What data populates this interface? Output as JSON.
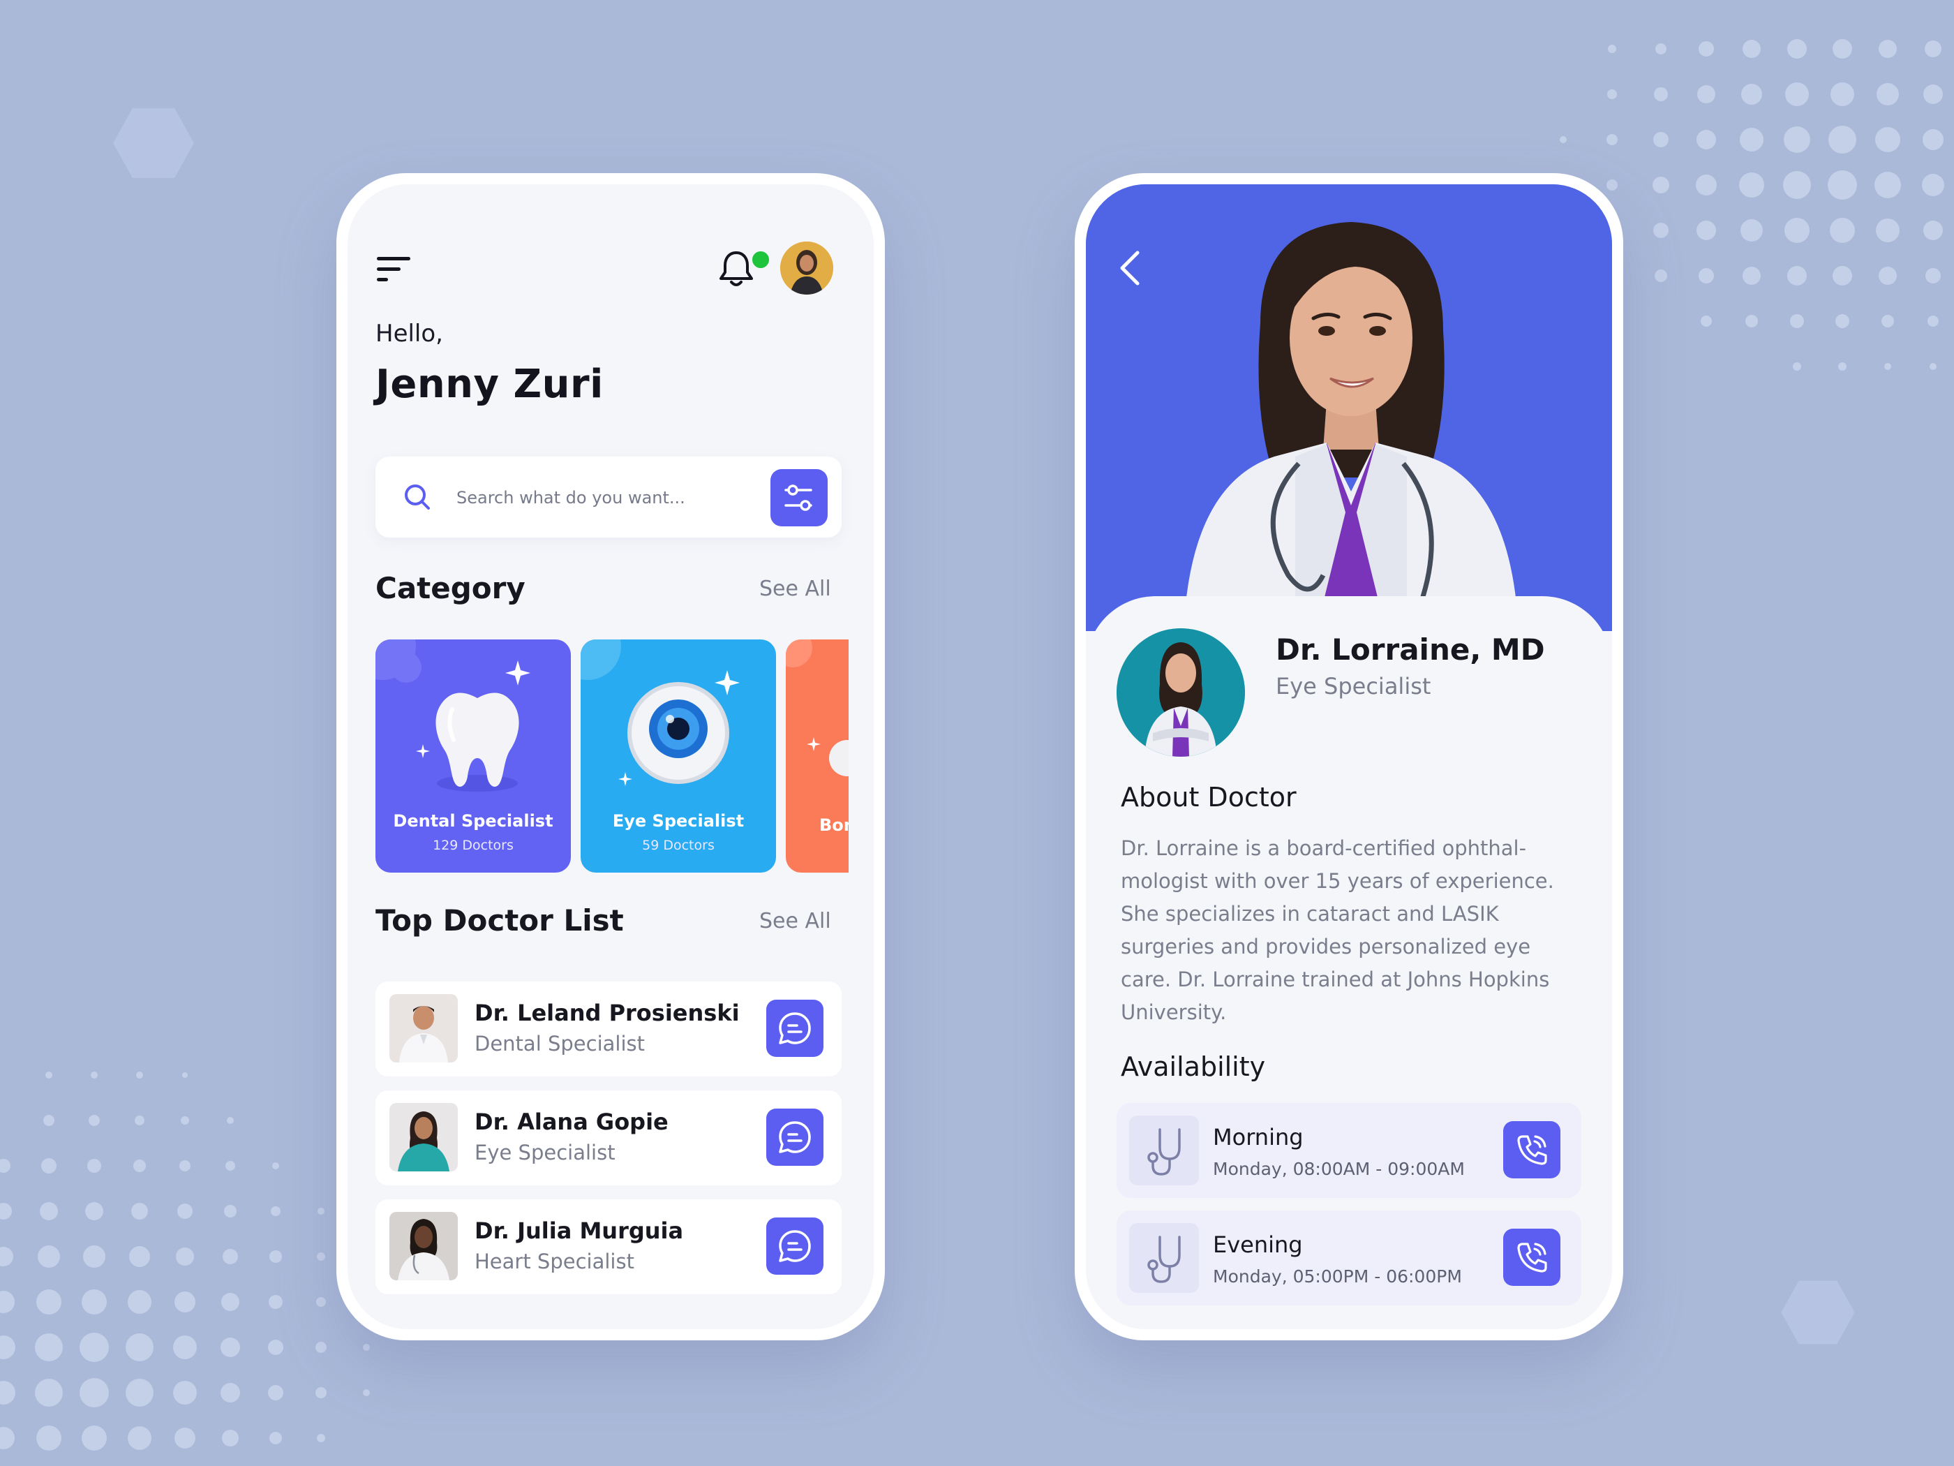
{
  "home": {
    "greeting": "Hello,",
    "user_name": "Jenny Zuri",
    "search": {
      "placeholder": "Search what do you want..."
    },
    "category_section": {
      "title": "Category",
      "see_all": "See All"
    },
    "categories": [
      {
        "title": "Dental Specialist",
        "count": "129 Doctors",
        "color": "#6262f3"
      },
      {
        "title": "Eye Specialist",
        "count": "59 Doctors",
        "color": "#28abf1"
      },
      {
        "title": "Bon",
        "color": "#fb7a58"
      }
    ],
    "doctor_section": {
      "title": "Top Doctor List",
      "see_all": "See All"
    },
    "doctors": [
      {
        "name": "Dr. Leland Prosienski",
        "specialty": "Dental Specialist"
      },
      {
        "name": "Dr. Alana Gopie",
        "specialty": "Eye Specialist"
      },
      {
        "name": "Dr. Julia Murguia",
        "specialty": "Heart Specialist"
      }
    ],
    "accent": "#5b5ef0",
    "notification_dot_color": "#1ec43c"
  },
  "detail": {
    "name": "Dr. Lorraine, MD",
    "specialty": "Eye Specialist",
    "about_title": "About Doctor",
    "about_lines": [
      "Dr. Lorraine is a board-certified ophthal-",
      "mologist with over 15 years of experience.",
      "She specializes in cataract and LASIK",
      "surgeries and provides personalized eye",
      "care. Dr. Lorraine trained at Johns Hopkins",
      "University."
    ],
    "availability_title": "Availability",
    "slots": [
      {
        "label": "Morning",
        "time": "Monday, 08:00AM - 09:00AM"
      },
      {
        "label": "Evening",
        "time": "Monday, 05:00PM - 06:00PM"
      }
    ],
    "hero_color": "#4f65e6"
  },
  "icons": {
    "menu": "menu-icon",
    "notification": "bell-icon",
    "search": "search-icon",
    "filter": "filter-icon",
    "chat": "chat-icon",
    "back": "chevron-left-icon",
    "stethoscope": "stethoscope-icon",
    "call": "phone-icon"
  }
}
